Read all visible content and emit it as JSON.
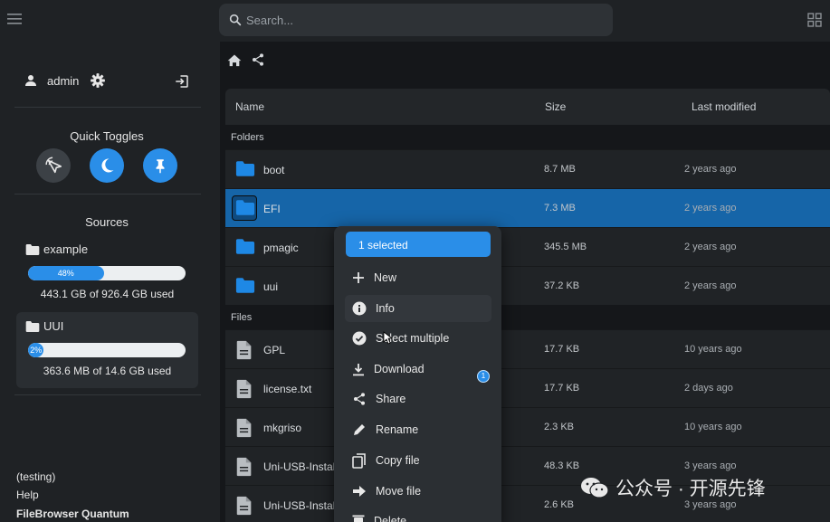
{
  "search": {
    "placeholder": "Search..."
  },
  "sidebar": {
    "user": "admin",
    "quick_toggles_title": "Quick Toggles",
    "sources_title": "Sources",
    "sources": [
      {
        "name": "example",
        "percent": 48,
        "percent_label": "48%",
        "usage": "443.1 GB of 926.4 GB used"
      },
      {
        "name": "UUI",
        "percent": 2,
        "percent_label": "2%",
        "usage": "363.6 MB of 14.6 GB used"
      }
    ],
    "footer": {
      "testing": "(testing)",
      "help": "Help",
      "brand": "FileBrowser Quantum"
    }
  },
  "table": {
    "columns": {
      "name": "Name",
      "size": "Size",
      "modified": "Last modified"
    },
    "folders_label": "Folders",
    "files_label": "Files",
    "folders": [
      {
        "name": "boot",
        "size": "8.7 MB",
        "modified": "2 years ago"
      },
      {
        "name": "EFI",
        "size": "7.3 MB",
        "modified": "2 years ago"
      },
      {
        "name": "pmagic",
        "size": "345.5 MB",
        "modified": "2 years ago"
      },
      {
        "name": "uui",
        "size": "37.2 KB",
        "modified": "2 years ago"
      }
    ],
    "files": [
      {
        "name": "GPL",
        "size": "17.7 KB",
        "modified": "10 years ago"
      },
      {
        "name": "license.txt",
        "size": "17.7 KB",
        "modified": "2 days ago"
      },
      {
        "name": "mkgriso",
        "size": "2.3 KB",
        "modified": "10 years ago"
      },
      {
        "name": "Uni-USB-Instal",
        "size": "48.3 KB",
        "modified": "3 years ago"
      },
      {
        "name": "Uni-USB-Instal",
        "size": "2.6 KB",
        "modified": "3 years ago"
      }
    ]
  },
  "context_menu": {
    "selected": "1 selected",
    "items": [
      "New",
      "Info",
      "Select multiple",
      "Download",
      "Share",
      "Rename",
      "Copy file",
      "Move file",
      "Delete"
    ],
    "download_badge": "1"
  },
  "watermark": "公众号 · 开源先锋",
  "colors": {
    "accent": "#2a8ee8",
    "selected_row": "#1665a8",
    "folder": "#1e88e5"
  }
}
